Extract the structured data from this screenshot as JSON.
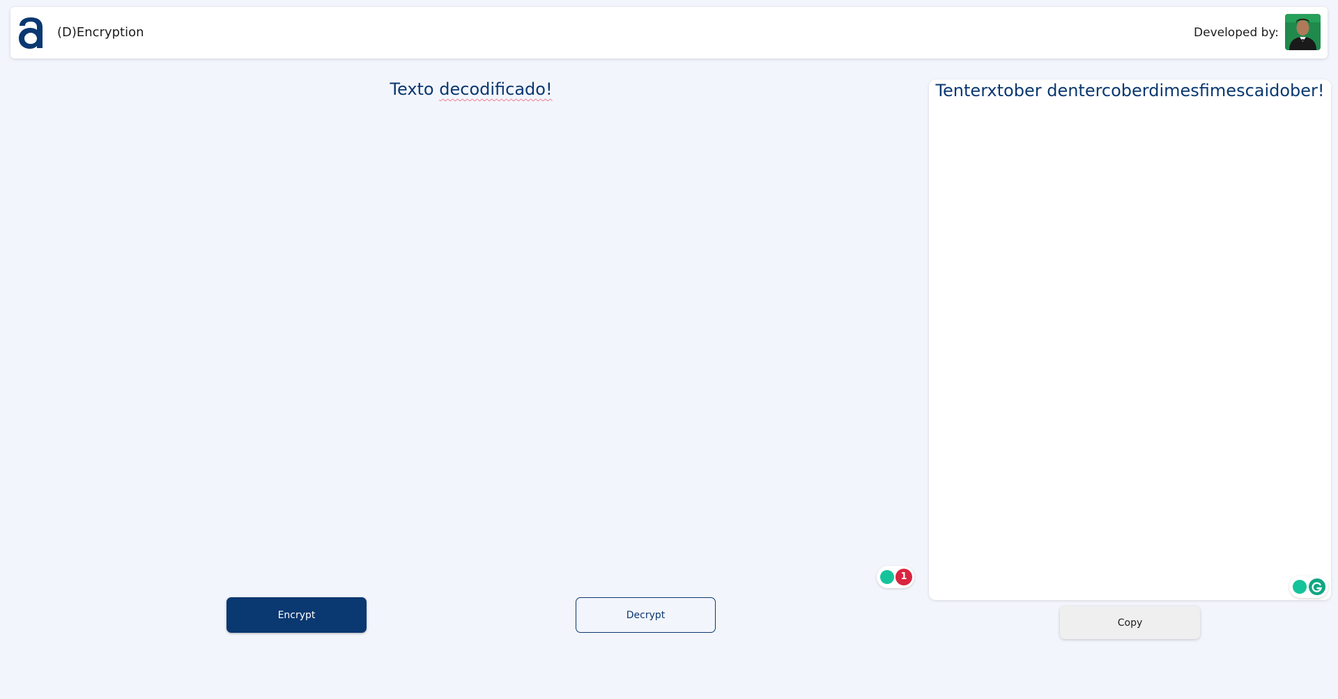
{
  "header": {
    "app_title": "(D)Encryption",
    "developer_label": "Developed by:",
    "logo_icon": "alura-a-logo",
    "avatar_icon": "developer-avatar"
  },
  "input": {
    "text_plain": "Texto ",
    "text_underlined": "decodificado!"
  },
  "output": {
    "text": "Tenterxtober dentercoberdimesfimescaidober!"
  },
  "buttons": {
    "encrypt": "Encrypt",
    "decrypt": "Decrypt",
    "copy": "Copy"
  },
  "grammarly": {
    "input_badge_count": "1",
    "input_icon": "grammarly-suggestion-icon",
    "output_icon": "grammarly-g-icon"
  },
  "colors": {
    "primary": "#0a3871",
    "background": "#f3f5fc",
    "grammarly_green": "#15c39a",
    "badge_red": "#d9253f"
  }
}
